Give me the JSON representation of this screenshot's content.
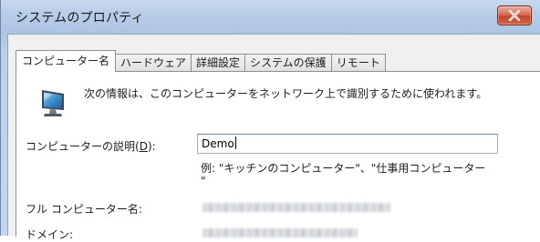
{
  "window": {
    "title": "システムのプロパティ",
    "close_icon": "close-icon"
  },
  "tabs": [
    {
      "label": "コンピューター名",
      "active": true
    },
    {
      "label": "ハードウェア",
      "active": false
    },
    {
      "label": "詳細設定",
      "active": false
    },
    {
      "label": "システムの保護",
      "active": false
    },
    {
      "label": "リモート",
      "active": false
    }
  ],
  "computer_name_tab": {
    "info_icon": "computer-monitor-icon",
    "info_text": "次の情報は、このコンピューターをネットワーク上で識別するために使われます。",
    "description": {
      "label_prefix": "コンピューターの説明(",
      "label_accel": "D",
      "label_suffix": "):",
      "value": "Demo"
    },
    "example_text": "例: \"キッチンのコンピューター\"、\"仕事用コンピューター",
    "example_tail": "\"",
    "full_name_label": "フル コンピューター名:",
    "domain_label": "ドメイン:"
  }
}
